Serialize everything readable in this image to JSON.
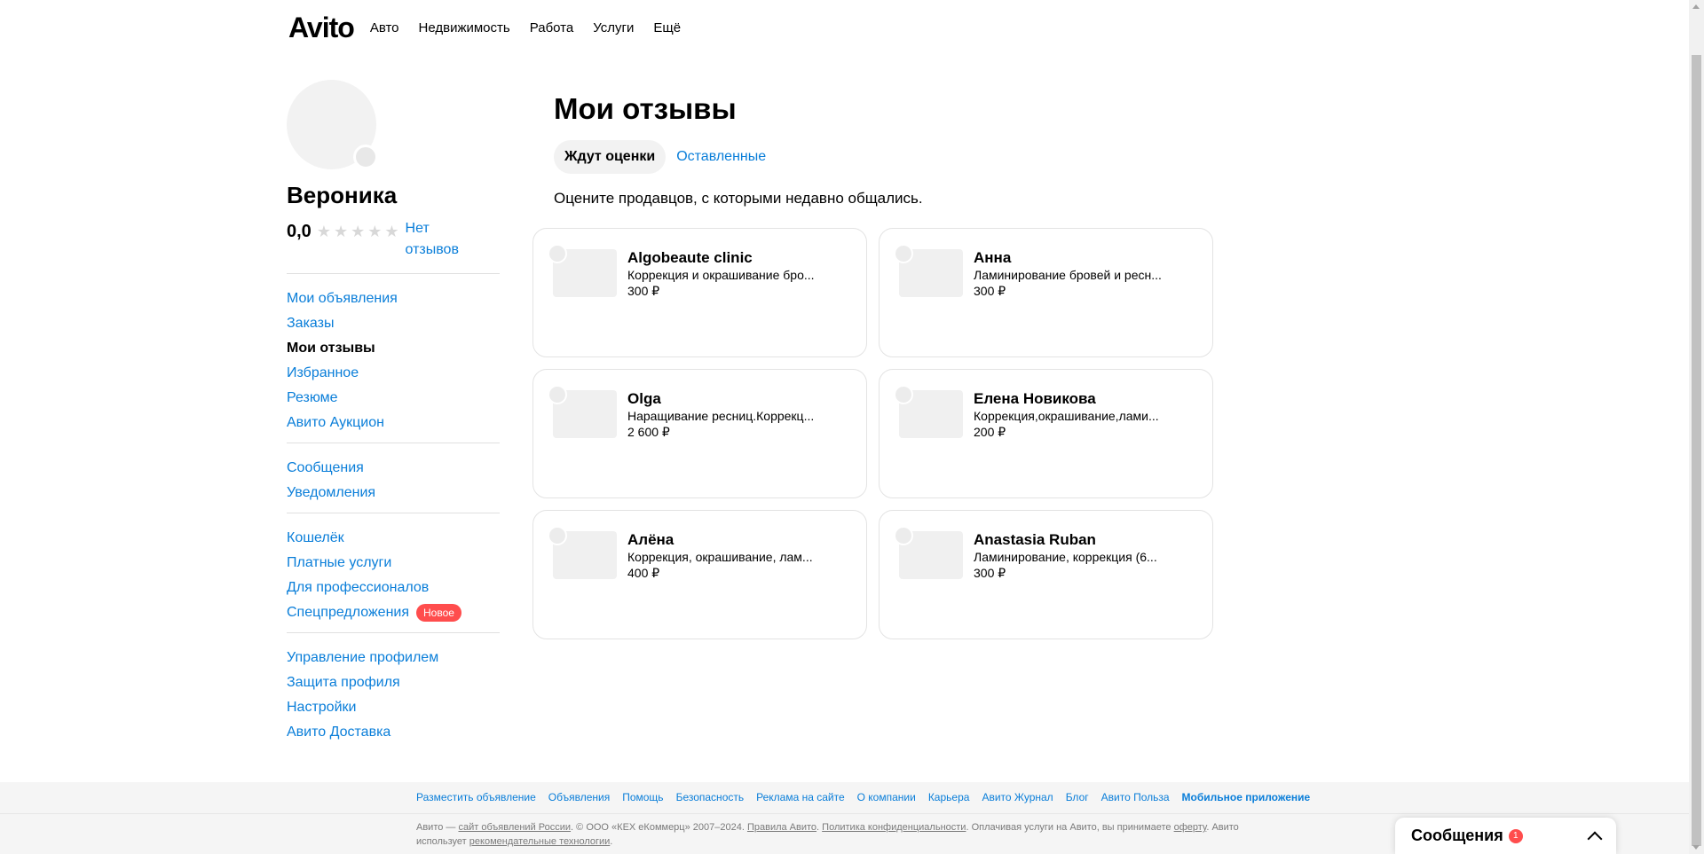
{
  "header": {
    "logo": "Avito",
    "nav": [
      "Авто",
      "Недвижимость",
      "Работа",
      "Услуги",
      "Ещё"
    ]
  },
  "profile": {
    "name": "Вероника",
    "rating": "0,0",
    "stars": 0,
    "no_reviews": "Нет отзывов"
  },
  "sidebar": {
    "groups": [
      [
        {
          "label": "Мои объявления",
          "active": false
        },
        {
          "label": "Заказы",
          "active": false
        },
        {
          "label": "Мои отзывы",
          "active": true
        },
        {
          "label": "Избранное",
          "active": false
        },
        {
          "label": "Резюме",
          "active": false
        },
        {
          "label": "Авито Аукцион",
          "active": false
        }
      ],
      [
        {
          "label": "Сообщения",
          "active": false
        },
        {
          "label": "Уведомления",
          "active": false
        }
      ],
      [
        {
          "label": "Кошелёк",
          "active": false
        },
        {
          "label": "Платные услуги",
          "active": false
        },
        {
          "label": "Для профессионалов",
          "active": false
        },
        {
          "label": "Спецпредложения",
          "active": false,
          "badge": "Новое"
        }
      ],
      [
        {
          "label": "Управление профилем",
          "active": false
        },
        {
          "label": "Защита профиля",
          "active": false
        },
        {
          "label": "Настройки",
          "active": false
        },
        {
          "label": "Авито Доставка",
          "active": false
        }
      ]
    ]
  },
  "main": {
    "title": "Мои отзывы",
    "tabs": [
      {
        "label": "Ждут оценки",
        "active": true
      },
      {
        "label": "Оставленные",
        "active": false
      }
    ],
    "subtitle": "Оцените продавцов, с которыми недавно общались.",
    "cards": [
      {
        "name": "Algobeaute clinic",
        "desc": "Коррекция и окрашивание бро...",
        "price": "300 ₽"
      },
      {
        "name": "Анна",
        "desc": "Ламинирование бровей и ресн...",
        "price": "300 ₽"
      },
      {
        "name": "Olga",
        "desc": "Наращивание ресниц.Коррекц...",
        "price": "2 600 ₽"
      },
      {
        "name": "Елена Новикова",
        "desc": "Коррекция,окрашивание,лами...",
        "price": "200 ₽"
      },
      {
        "name": "Алёна",
        "desc": "Коррекция, окрашивание, лам...",
        "price": "400 ₽"
      },
      {
        "name": "Anastasia Ruban",
        "desc": "Ламинирование, коррекция (6...",
        "price": "300 ₽"
      }
    ]
  },
  "footer": {
    "links": [
      {
        "label": "Разместить объявление",
        "bold": false
      },
      {
        "label": "Объявления",
        "bold": false
      },
      {
        "label": "Помощь",
        "bold": false
      },
      {
        "label": "Безопасность",
        "bold": false
      },
      {
        "label": "Реклама на сайте",
        "bold": false
      },
      {
        "label": "О компании",
        "bold": false
      },
      {
        "label": "Карьера",
        "bold": false
      },
      {
        "label": "Авито Журнал",
        "bold": false
      },
      {
        "label": "Блог",
        "bold": false
      },
      {
        "label": "Авито Польза",
        "bold": false
      },
      {
        "label": "Мобильное приложение",
        "bold": true
      }
    ],
    "copy": {
      "prefix": "Авито — ",
      "link1": "сайт объявлений России",
      "mid1": ". © ООО «КЕХ еКоммерц» 2007–2024. ",
      "link2": "Правила Авито",
      "mid2": ". ",
      "link3": "Политика конфиденциальности",
      "mid3": ". Оплачивая услуги на Авито, вы принимаете ",
      "link4": "оферту",
      "mid4": ". Авито использует ",
      "link5": "рекомендательные технологии",
      "suffix": "."
    }
  },
  "messages_widget": {
    "label": "Сообщения",
    "count": "1"
  }
}
